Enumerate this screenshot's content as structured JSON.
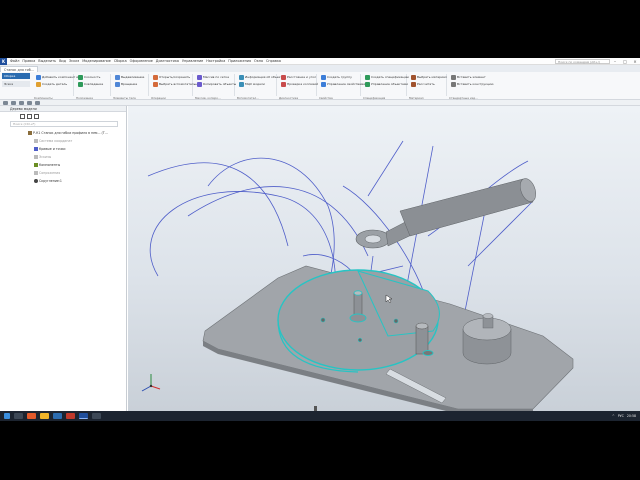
{
  "titlebar": {
    "logo": "K",
    "menu": [
      "Файл",
      "Правка",
      "Выделить",
      "Вид",
      "Эскиз",
      "Моделирование",
      "Сборка",
      "Оформление",
      "Диагностика",
      "Управление",
      "Настройка",
      "Приложения",
      "Окно",
      "Справка"
    ],
    "search_placeholder": "Поиск по командам (Alt+/)"
  },
  "tabs": [
    "Станок для гиб..."
  ],
  "ribbon": {
    "left": [
      "Сборка",
      "Эскиз",
      "Усреднение"
    ],
    "buttons": [
      "Добавить компонент из...",
      "Создать деталь",
      "Соосность",
      "Совпадение",
      "Выдавливание",
      "Вращение",
      "Открыть/сохранить",
      "Выбрать вспомогательный",
      "Массив по сетке",
      "Копировать объекты",
      "Информация об объекте",
      "МЦХ модели",
      "Расстояние и угол",
      "Проверка коллизий",
      "Создать группу",
      "Управление свойствами",
      "Создать спецификацию",
      "Управление объектами",
      "Выбрать материал",
      "Рассчитать",
      "Вставить элемент",
      "Вставить конструкцию"
    ],
    "group_labels": [
      "Системная",
      "Компоненты",
      "Положение",
      "Элементы тела",
      "Операции",
      "Массив, копиро...",
      "Вспомогател...",
      "Диагностика",
      "Свойства",
      "Спецификация",
      "Материал",
      "Стандартные изд..."
    ]
  },
  "panel": {
    "title": "Дерево модели",
    "search_placeholder": "Поиск (Ctrl+F)",
    "tree": [
      {
        "label": "Р-К1 Станок для гибки профиля в нем... (Т...",
        "indent": 0,
        "dim": false
      },
      {
        "label": "Система координат",
        "indent": 1,
        "dim": true
      },
      {
        "label": "Кривые и точки",
        "indent": 1,
        "dim": false
      },
      {
        "label": "Эскизы",
        "indent": 1,
        "dim": true
      },
      {
        "label": "Компоненты",
        "indent": 1,
        "dim": false
      },
      {
        "label": "Сопряжения",
        "indent": 1,
        "dim": true
      },
      {
        "label": "Скругление:1",
        "indent": 1,
        "dim": false
      }
    ]
  },
  "taskbar": {
    "lang": "РУС",
    "time": "20:58"
  },
  "colors": {
    "accent": "#2b6cb0",
    "model_grey": "#9a9ea3",
    "wire_blue": "#4f5ec9",
    "select_cyan": "#27c4c4"
  }
}
